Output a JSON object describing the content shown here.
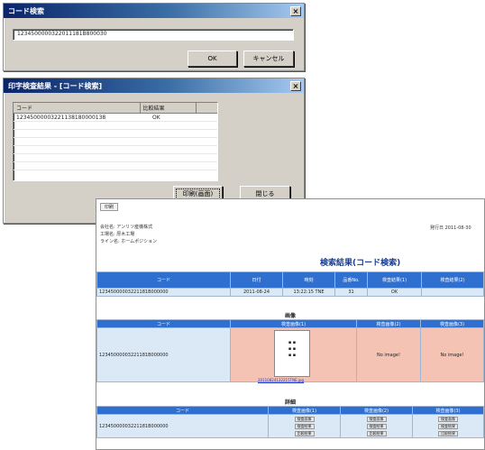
{
  "dialog_search": {
    "title": "コード検索",
    "input_value": "1234500000322011181B800030",
    "ok_label": "OK",
    "cancel_label": "キャンセル"
  },
  "dialog_result": {
    "title": "印字検査結果 - [コード検索]",
    "columns": [
      "コード",
      "比較結果"
    ],
    "rows": [
      {
        "code": "12345000003221138180000138",
        "result": "OK"
      }
    ],
    "print_button": "印刷(画面)",
    "close_button": "閉じる"
  },
  "report": {
    "tab": "印刷",
    "print_date": "発行日 2011-08-30",
    "info_lines": [
      "会社名: アンリツ産機株式",
      "工場名: 厚木工場",
      "ライン名: ホームポジション"
    ],
    "title": "検索結果(コード検索)",
    "main_headers": [
      "コード",
      "日付",
      "時刻",
      "品番No.",
      "検査結果(1)",
      "検査結果(2)"
    ],
    "main_row": [
      "12345000003221181B000000",
      "2011-08-24",
      "13:22:15 TNE",
      "31",
      "OK",
      ""
    ],
    "image_section": "画像",
    "image_headers": [
      "コード",
      "検査画像(1)",
      "検査画像(2)",
      "検査画像(3)"
    ],
    "image_row_code": "12345000003221181B000000",
    "image_link": "20110824132215TNE.jpg",
    "no_image": "No image!",
    "detail_section": "詳細",
    "detail_headers": [
      "コード",
      "検査画像(1)",
      "検査画像(2)",
      "検査画像(3)"
    ],
    "detail_row_code": "12345000003221181B000000",
    "detail_links": [
      "検査画像",
      "検査結果",
      "比較結果"
    ]
  }
}
